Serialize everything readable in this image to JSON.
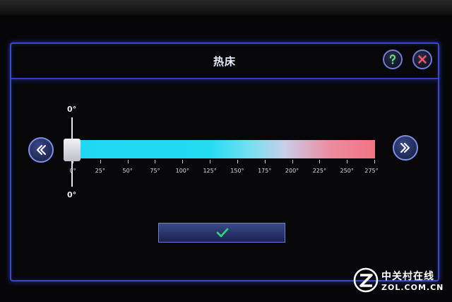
{
  "dialog": {
    "title": "热床",
    "help_icon": "question-icon",
    "close_icon": "close-icon"
  },
  "temperature": {
    "top_value": "0°",
    "bottom_value": "0°",
    "scale_min": 0,
    "scale_max": 275,
    "current": 0,
    "tick_labels": [
      "0°",
      "25°",
      "50°",
      "75°",
      "100°",
      "125°",
      "150°",
      "175°",
      "200°",
      "225°",
      "250°",
      "275°"
    ],
    "colors": {
      "cold": "#20d8f2",
      "hot": "#f07484"
    }
  },
  "navigation": {
    "prev_icon": "double-chevron-left-icon",
    "next_icon": "double-chevron-right-icon"
  },
  "confirm": {
    "icon": "checkmark-icon",
    "color": "#2fd27a"
  },
  "watermark": {
    "cn": "中关村在线",
    "en": "ZOL.COM.CN"
  }
}
